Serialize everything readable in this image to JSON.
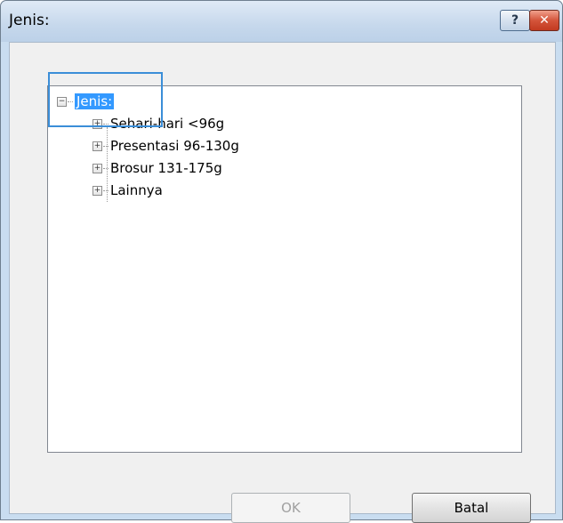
{
  "window": {
    "title": "Jenis:",
    "help_glyph": "?",
    "close_glyph": "✕"
  },
  "tree": {
    "root": {
      "label": "Jenis:",
      "expanded": true,
      "expander_glyph": "−"
    },
    "items": [
      {
        "label": "Sehari-hari <96g",
        "expander_glyph": "+"
      },
      {
        "label": "Presentasi 96-130g",
        "expander_glyph": "+"
      },
      {
        "label": "Brosur 131-175g",
        "expander_glyph": "+"
      },
      {
        "label": "Lainnya",
        "expander_glyph": "+"
      }
    ]
  },
  "buttons": {
    "ok_label": "OK",
    "cancel_label": "Batal"
  },
  "colors": {
    "selection": "#3399ff",
    "focus_outline": "#3b8ed8"
  }
}
